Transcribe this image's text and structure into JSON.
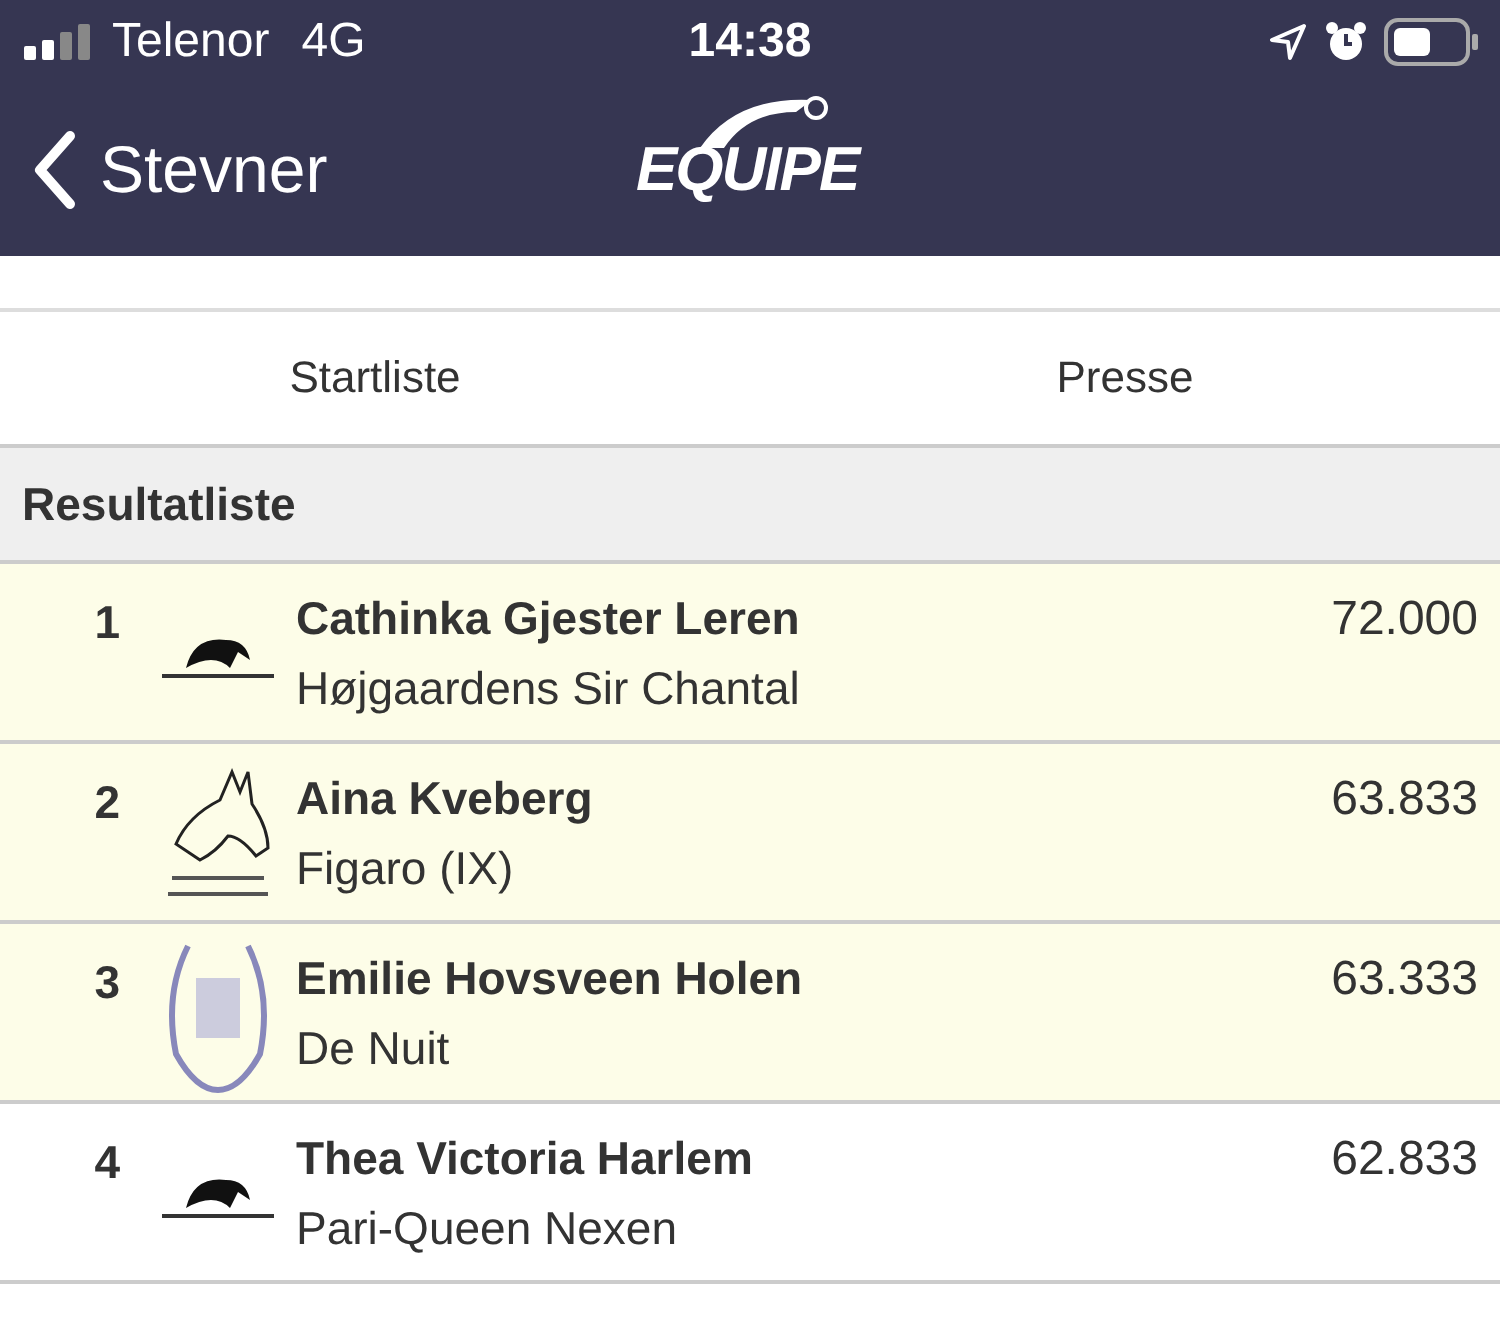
{
  "status_bar": {
    "carrier": "Telenor",
    "network": "4G",
    "time": "14:38"
  },
  "nav": {
    "back": "Stevner",
    "logo": "EQUIPE"
  },
  "tabs": [
    {
      "label": "Startliste"
    },
    {
      "label": "Presse"
    }
  ],
  "section": "Resultatliste",
  "results": [
    {
      "rank": "1",
      "kind": "cap",
      "rider": "Cathinka Gjester Leren",
      "horse": "Højgaardens Sir Chantal",
      "score": "72.000",
      "highlighted": true
    },
    {
      "rank": "2",
      "kind": "head",
      "rider": "Aina Kveberg",
      "horse": "Figaro (IX)",
      "score": "63.833",
      "highlighted": true
    },
    {
      "rank": "3",
      "kind": "shoe",
      "rider": "Emilie Hovsveen Holen",
      "horse": "De Nuit",
      "score": "63.333",
      "highlighted": true
    },
    {
      "rank": "4",
      "kind": "cap",
      "rider": "Thea Victoria Harlem",
      "horse": "Pari-Queen Nexen",
      "score": "62.833",
      "highlighted": false
    }
  ]
}
